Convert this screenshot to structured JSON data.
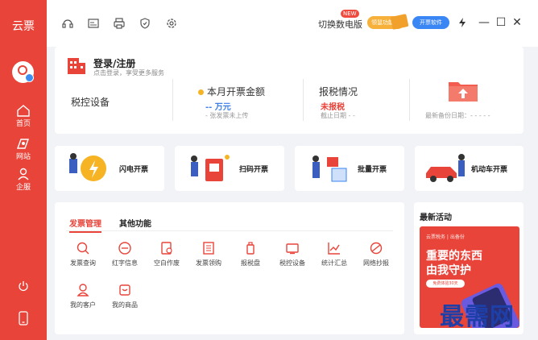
{
  "app": {
    "name": "云票"
  },
  "sidebar": {
    "items": [
      {
        "label": "首页",
        "icon": "home-icon"
      },
      {
        "label": "网站",
        "icon": "website-icon"
      },
      {
        "label": "企服",
        "icon": "enterprise-icon"
      }
    ]
  },
  "topbar": {
    "switch_label": "切换数电版",
    "new_badge": "NEW",
    "pill_left": "领鼠功能",
    "pill_right": "开票软件",
    "colors": {
      "accent": "#e8443a",
      "blue": "#3b86f5",
      "orange": "#f7b03a"
    }
  },
  "login": {
    "title": "登录/注册",
    "subtitle": "点击登录，享受更多服务",
    "tax_device": "税控设备",
    "amount_title": "本月开票金额",
    "amount_value": "-- 万元",
    "amount_sub": "- 张发票未上传",
    "report_title": "报税情况",
    "report_value": "未报税",
    "report_sub": "截止日期 - -",
    "backup_sub": "最新备份日期：- - - - -"
  },
  "features": [
    {
      "label": "闪电开票"
    },
    {
      "label": "扫码开票"
    },
    {
      "label": "批量开票"
    },
    {
      "label": "机动车开票"
    }
  ],
  "main": {
    "tabs": [
      {
        "label": "发票管理"
      },
      {
        "label": "其他功能"
      }
    ],
    "functions": [
      {
        "label": "发票查询",
        "icon": "search-icon"
      },
      {
        "label": "红字信息",
        "icon": "minus-circle-icon"
      },
      {
        "label": "空白作废",
        "icon": "void-icon"
      },
      {
        "label": "发票领购",
        "icon": "purchase-icon"
      },
      {
        "label": "报税盘",
        "icon": "tax-disk-icon"
      },
      {
        "label": "税控设备",
        "icon": "device-icon"
      },
      {
        "label": "统计汇总",
        "icon": "chart-icon"
      },
      {
        "label": "网络抄报",
        "icon": "network-icon"
      },
      {
        "label": "我的客户",
        "icon": "customer-icon"
      },
      {
        "label": "我的商品",
        "icon": "goods-icon"
      }
    ]
  },
  "activity": {
    "title": "最新活动",
    "banner_small": "云票税务 | 出备份",
    "banner_big": "重要的东西\n由我守护",
    "banner_button": "免费体验30天"
  },
  "watermark": "最需网"
}
